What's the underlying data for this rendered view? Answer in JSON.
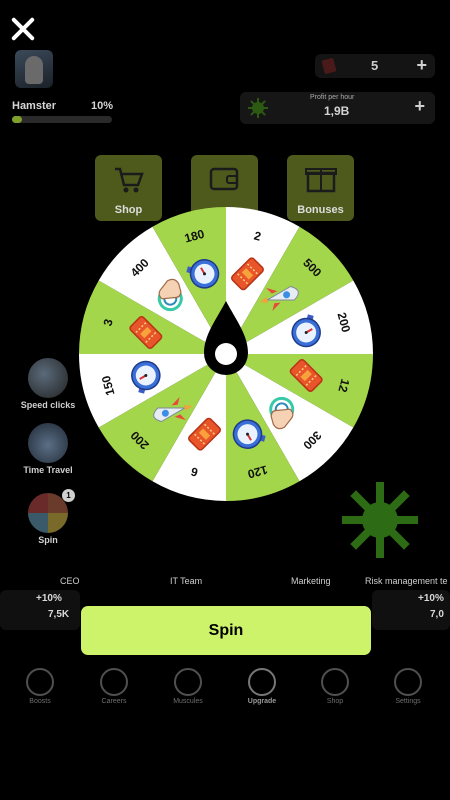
{
  "close_label": "",
  "player": {
    "name": "Hamster",
    "level_percent": "10%",
    "progress": 0.1
  },
  "keys": {
    "count": "5",
    "plus": "+"
  },
  "profit": {
    "label": "Profit per hour",
    "value": "1,9B",
    "plus": "+"
  },
  "top_tiles": [
    {
      "label": "Shop",
      "icon": "shopping-cart-icon"
    },
    {
      "label": "",
      "icon": "wallet-icon"
    },
    {
      "label": "Bonuses",
      "icon": "gift-icon"
    }
  ],
  "side_items": [
    {
      "label": "Speed clicks",
      "icon": "rocket-icon"
    },
    {
      "label": "Time Travel",
      "icon": "stopwatch-icon"
    },
    {
      "label": "Spin",
      "icon": "wheel-icon",
      "badge": "1"
    }
  ],
  "cards": [
    {
      "title": "CEO",
      "bonus": "+10%",
      "value": "7,5K"
    },
    {
      "title": "IT Team"
    },
    {
      "title": "Marketing"
    },
    {
      "title": "Risk management te",
      "bonus": "+10%",
      "value": "7,0"
    }
  ],
  "bottom_nav": [
    {
      "label": "Boosts",
      "icon": "skull-icon"
    },
    {
      "label": "Careers",
      "icon": "brain-icon"
    },
    {
      "label": "Muscules",
      "icon": "muscle-icon"
    },
    {
      "label": "Upgrade",
      "icon": "upgrade-icon"
    },
    {
      "label": "Shop",
      "icon": "cart-icon"
    },
    {
      "label": "Settings",
      "icon": "gear-icon"
    }
  ],
  "wheel": {
    "colors": {
      "green": "#a3d64a",
      "white": "#ffffff",
      "pointer": "#000000"
    },
    "segments": [
      {
        "value": "2",
        "icon": "ticket-icon"
      },
      {
        "value": "500",
        "icon": "rocket-icon"
      },
      {
        "value": "200",
        "icon": "stopwatch-icon"
      },
      {
        "value": "12",
        "icon": "ticket-icon"
      },
      {
        "value": "300",
        "icon": "tap-hand-icon"
      },
      {
        "value": "120",
        "icon": "stopwatch-icon"
      },
      {
        "value": "6",
        "icon": "ticket-icon"
      },
      {
        "value": "200",
        "icon": "rocket-icon"
      },
      {
        "value": "150",
        "icon": "stopwatch-icon"
      },
      {
        "value": "3",
        "icon": "ticket-icon"
      },
      {
        "value": "400",
        "icon": "tap-hand-icon"
      },
      {
        "value": "180",
        "icon": "stopwatch-icon"
      }
    ]
  },
  "spin_button": {
    "label": "Spin"
  },
  "accent_color": "#cdf36b"
}
